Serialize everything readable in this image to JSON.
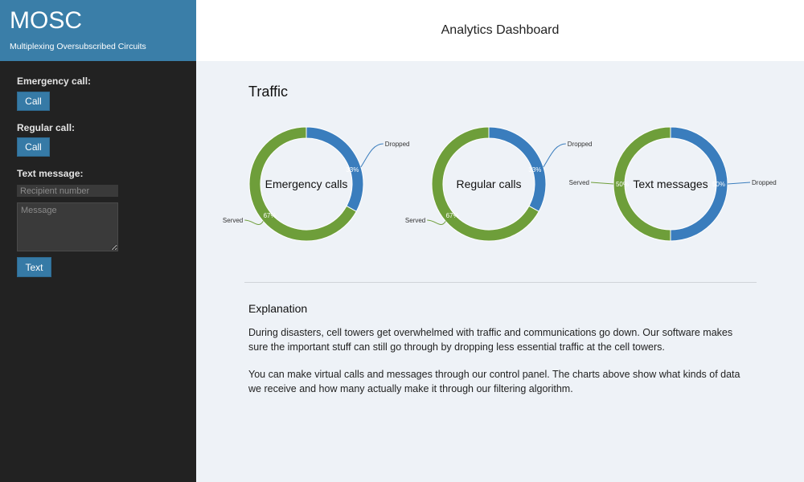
{
  "brand": {
    "title": "MOSC",
    "subtitle": "Multiplexing Oversubscribed Circuits"
  },
  "sidebar": {
    "emergency_label": "Emergency call:",
    "emergency_button": "Call",
    "regular_label": "Regular call:",
    "regular_button": "Call",
    "text_label": "Text message:",
    "recipient_placeholder": "Recipient number",
    "message_placeholder": "Message",
    "text_button": "Text"
  },
  "header": {
    "title": "Analytics Dashboard"
  },
  "main": {
    "traffic_title": "Traffic",
    "explanation_title": "Explanation",
    "paragraphs": [
      "During disasters, cell towers get overwhelmed with traffic and communications go down. Our software makes sure the important stuff can still go through by dropping less essential traffic at the cell towers.",
      "You can make virtual calls and messages through our control panel. The charts above show what kinds of data we receive and how many actually make it through our filtering algorithm."
    ]
  },
  "colors": {
    "served": "#6e9e3a",
    "dropped": "#3a7dbd",
    "brand": "#3a7ea8"
  },
  "chart_data": [
    {
      "type": "pie",
      "title": "Emergency calls",
      "categories": [
        "Dropped",
        "Served"
      ],
      "values": [
        33,
        67
      ],
      "labels": [
        "33%",
        "67%"
      ]
    },
    {
      "type": "pie",
      "title": "Regular calls",
      "categories": [
        "Dropped",
        "Served"
      ],
      "values": [
        33,
        67
      ],
      "labels": [
        "33%",
        "67%"
      ]
    },
    {
      "type": "pie",
      "title": "Text messages",
      "categories": [
        "Dropped",
        "Served"
      ],
      "values": [
        50,
        50
      ],
      "labels": [
        "50%",
        "50%"
      ]
    }
  ]
}
